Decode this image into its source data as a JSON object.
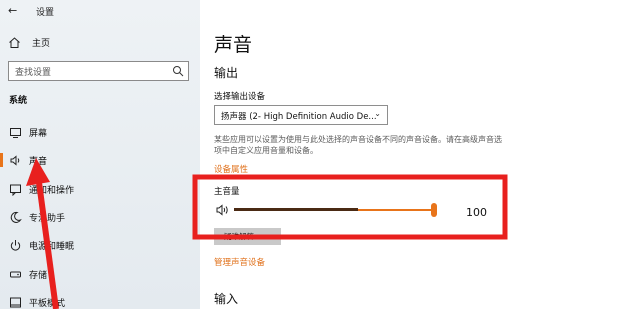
{
  "window": {
    "title": "设置",
    "back_glyph": "←"
  },
  "sidebar": {
    "home_label": "主页",
    "search_placeholder": "查找设置",
    "section_title": "系统",
    "items": [
      {
        "label": "屏幕",
        "icon": "monitor-icon"
      },
      {
        "label": "声音",
        "icon": "speaker-icon",
        "active": true
      },
      {
        "label": "通知和操作",
        "icon": "notification-icon"
      },
      {
        "label": "专注助手",
        "icon": "moon-icon"
      },
      {
        "label": "电源和睡眠",
        "icon": "power-icon"
      },
      {
        "label": "存储",
        "icon": "storage-icon"
      },
      {
        "label": "平板模式",
        "icon": "tablet-icon"
      }
    ]
  },
  "main": {
    "title": "声音",
    "output_heading": "输出",
    "choose_output_label": "选择输出设备",
    "output_device": "扬声器 (2- High Definition Audio De...",
    "description": "某些应用可以设置为使用与此处选择的声音设备不同的声音设备。请在高级声音选项中自定义应用音量和设备。",
    "device_properties_link": "设备属性",
    "master_volume_label": "主音量",
    "volume_value": "100",
    "volume_fraction": 1.0,
    "troubleshoot_label": "疑难解答",
    "manage_devices_link": "管理声音设备",
    "input_heading": "输入"
  },
  "colors": {
    "accent": "#e8741a",
    "annotation": "#e8201e"
  }
}
